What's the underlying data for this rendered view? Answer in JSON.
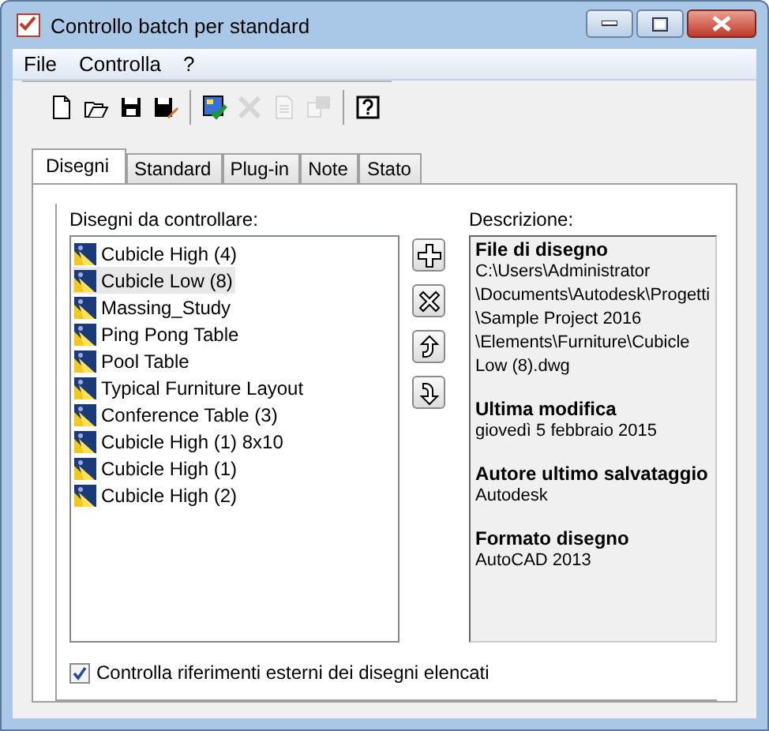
{
  "window": {
    "title": "Controllo batch per standard"
  },
  "menu": [
    "File",
    "Controlla",
    "?"
  ],
  "toolbar": [
    {
      "kind": "new",
      "disabled": false
    },
    {
      "kind": "open",
      "disabled": false
    },
    {
      "kind": "save",
      "disabled": false
    },
    {
      "kind": "saveas",
      "disabled": false
    },
    {
      "kind": "sep"
    },
    {
      "kind": "check",
      "disabled": false
    },
    {
      "kind": "delete",
      "disabled": true
    },
    {
      "kind": "report",
      "disabled": true
    },
    {
      "kind": "export",
      "disabled": true
    },
    {
      "kind": "sep"
    },
    {
      "kind": "help",
      "disabled": false
    }
  ],
  "tabs": [
    {
      "label": "Disegni",
      "selected": true
    },
    {
      "label": "Standard",
      "selected": false
    },
    {
      "label": "Plug-in",
      "selected": false
    },
    {
      "label": "Note",
      "selected": false
    },
    {
      "label": "Stato",
      "selected": false
    }
  ],
  "drawings": {
    "label": "Disegni da controllare:",
    "items": [
      {
        "name": "Cubicle High (4)",
        "selected": false
      },
      {
        "name": "Cubicle Low (8)",
        "selected": true
      },
      {
        "name": "Massing_Study",
        "selected": false
      },
      {
        "name": "Ping Pong Table",
        "selected": false
      },
      {
        "name": "Pool Table",
        "selected": false
      },
      {
        "name": "Typical Furniture Layout",
        "selected": false
      },
      {
        "name": "Conference Table (3)",
        "selected": false
      },
      {
        "name": "Cubicle High (1) 8x10",
        "selected": false
      },
      {
        "name": "Cubicle High (1)",
        "selected": false
      },
      {
        "name": "Cubicle High (2)",
        "selected": false
      }
    ]
  },
  "side_buttons": [
    {
      "kind": "add"
    },
    {
      "kind": "remove"
    },
    {
      "kind": "up"
    },
    {
      "kind": "down"
    }
  ],
  "description": {
    "label": "Descrizione:",
    "sections": [
      {
        "heading": "File di disegno",
        "value": "C:\\Users\\Administrator\\Documents\\Autodesk\\Progetti\\Sample Project 2016\\Elements\\Furniture\\Cubicle Low (8).dwg"
      },
      {
        "heading": "Ultima modifica",
        "value": "giovedì 5 febbraio 2015"
      },
      {
        "heading": "Autore ultimo salvataggio",
        "value": "Autodesk"
      },
      {
        "heading": "Formato disegno",
        "value": "AutoCAD 2013"
      }
    ]
  },
  "xref_check": {
    "label": "Controlla riferimenti esterni dei disegni elencati",
    "checked": true
  }
}
